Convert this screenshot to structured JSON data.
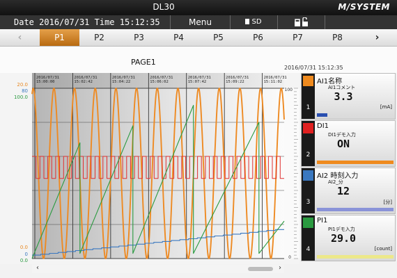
{
  "titlebar": {
    "title": "DL30",
    "logo": "M/SYSTEM"
  },
  "infobar": {
    "date_label": "Date",
    "date": "2016/07/31",
    "time_label": "Time",
    "time": "15:12:35",
    "menu": "Menu",
    "sd": "SD",
    "lock_icon": "lock-unlock-icon"
  },
  "tabs": [
    {
      "label": "‹",
      "kind": "prev"
    },
    {
      "label": "P1",
      "active": true
    },
    {
      "label": "P2"
    },
    {
      "label": "P3"
    },
    {
      "label": "P4"
    },
    {
      "label": "P5"
    },
    {
      "label": "P6"
    },
    {
      "label": "P7"
    },
    {
      "label": "P8"
    },
    {
      "label": "›",
      "kind": "next"
    }
  ],
  "page": {
    "title": "PAGE1",
    "timestamp": "2016/07/31 15:12:35"
  },
  "chart_data": {
    "type": "line",
    "x_tick_labels": [
      {
        "date": "2016/07/31",
        "time": "15:00:00"
      },
      {
        "date": "2016/07/31",
        "time": "15:02:42"
      },
      {
        "date": "2016/07/31",
        "time": "15:04:22"
      },
      {
        "date": "2016/07/31",
        "time": "15:06:02"
      },
      {
        "date": "2016/07/31",
        "time": "15:07:42"
      },
      {
        "date": "2016/07/31",
        "time": "15:09:22"
      },
      {
        "date": "2016/07/31",
        "time": "15:11:02"
      }
    ],
    "left_scales": [
      {
        "top": "20.0",
        "bottom": "0.0",
        "color": "#e88820"
      },
      {
        "top": "80",
        "bottom": "0",
        "color": "#3a78c0"
      },
      {
        "top": "100.0",
        "bottom": "0.0",
        "color": "#2a9a40"
      }
    ],
    "right_scale": {
      "top": "100",
      "bottom": "0"
    },
    "series": [
      {
        "channel": "AI1",
        "color": "#ee8a22",
        "shape": "sine",
        "min": 0,
        "max": 100,
        "cycles": 12.2
      },
      {
        "channel": "DI1",
        "color": "#e03030",
        "shape": "square",
        "low": 47,
        "high": 60,
        "cycles": 32
      },
      {
        "channel": "AI2",
        "color": "#3a78c0",
        "shape": "staircase",
        "start": 2,
        "end": 17
      },
      {
        "channel": "PI1",
        "color": "#2a9a40",
        "shape": "sawtooth",
        "ramps": [
          [
            0,
            0
          ],
          [
            19,
            68
          ],
          [
            19,
            3
          ],
          [
            40,
            78
          ],
          [
            40,
            3
          ],
          [
            64,
            90
          ],
          [
            64,
            3
          ],
          [
            90,
            80
          ],
          [
            90,
            3
          ],
          [
            100,
            22
          ]
        ]
      }
    ]
  },
  "channels": [
    {
      "name": "AI1名称",
      "comment": "AI1コメント",
      "value": "3.3",
      "unit": "[mA]",
      "color": "#ef8a1e",
      "index": "1",
      "bar_color": "#2a4fb0",
      "bar_fraction": 0.14
    },
    {
      "name": "DI1",
      "comment": "DI1デモ入力",
      "value": "ON",
      "unit": "",
      "color": "#e02020",
      "index": "2",
      "bar_color": "#ef8a1e",
      "bar_fraction": 1.0
    },
    {
      "name": "AI2 時刻入力",
      "comment": "AI2_分",
      "value": "12",
      "unit": "[分]",
      "color": "#3a78c0",
      "index": "3",
      "bar_color": "#8a93d8",
      "bar_fraction": 1.0
    },
    {
      "name": "PI1",
      "comment": "PI1デモ入力",
      "value": "29.0",
      "unit": "[count]",
      "color": "#2a9a40",
      "index": "4",
      "bar_color": "#ece88a",
      "bar_fraction": 1.0
    }
  ]
}
